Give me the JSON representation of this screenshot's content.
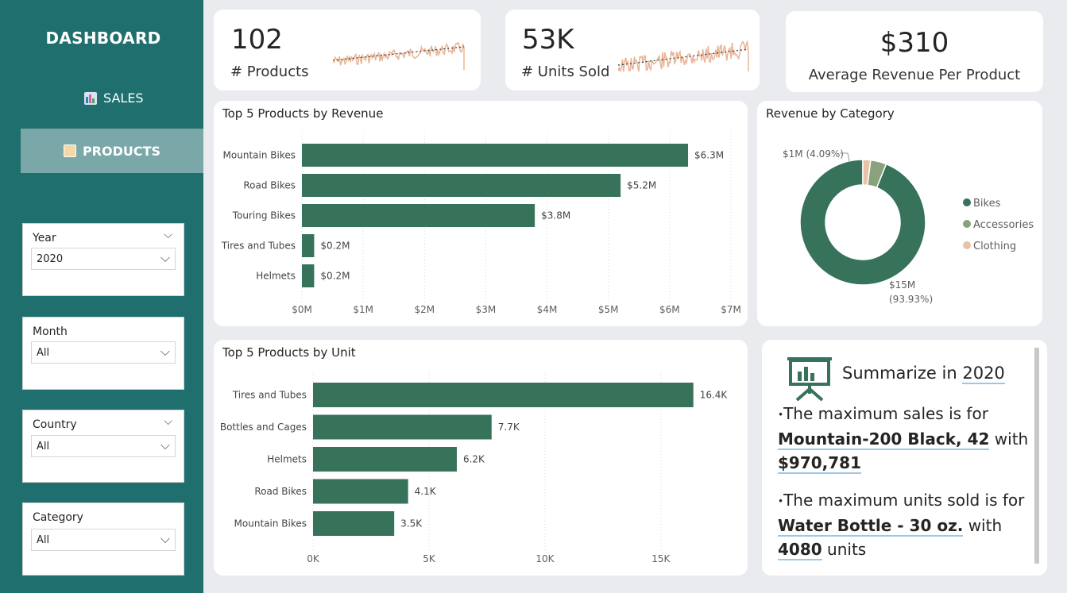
{
  "sidebar": {
    "title": "DASHBOARD",
    "nav": [
      {
        "label": "SALES"
      },
      {
        "label": "PRODUCTS"
      }
    ],
    "slicers": [
      {
        "label": "Year",
        "value": "2020"
      },
      {
        "label": "Month",
        "value": "All"
      },
      {
        "label": "Country",
        "value": "All"
      },
      {
        "label": "Category",
        "value": "All"
      }
    ]
  },
  "kpis": {
    "products": {
      "value": "102",
      "label": "# Products"
    },
    "units": {
      "value": "53K",
      "label": "# Units Sold"
    },
    "avg_rev": {
      "value": "$310",
      "label": "Average Revenue Per Product"
    }
  },
  "colors": {
    "sidebar": "#1f6f6e",
    "bar": "#36735a",
    "accessories": "#8aa27c",
    "clothing": "#e8c3a8",
    "sparkline": "#e8b596"
  },
  "chart_data": [
    {
      "type": "bar",
      "title": "Top 5 Products by Revenue",
      "categories": [
        "Mountain Bikes",
        "Road Bikes",
        "Touring Bikes",
        "Tires and Tubes",
        "Helmets"
      ],
      "values": [
        6.3,
        5.2,
        3.8,
        0.2,
        0.2
      ],
      "labels": [
        "$6.3M",
        "$5.2M",
        "$3.8M",
        "$0.2M",
        "$0.2M"
      ],
      "xticks": [
        "$0M",
        "$1M",
        "$2M",
        "$3M",
        "$4M",
        "$5M",
        "$6M",
        "$7M"
      ],
      "xlim": [
        0,
        7
      ],
      "grid": true
    },
    {
      "type": "pie",
      "title": "Revenue by Category",
      "labels": [
        "Bikes",
        "Accessories",
        "Clothing"
      ],
      "values": [
        93.93,
        4.09,
        1.98
      ],
      "annotations": [
        "$15M",
        "(93.93%)",
        "$1M (4.09%)"
      ],
      "legend": "right"
    },
    {
      "type": "bar",
      "title": "Top 5 Products by Unit",
      "categories": [
        "Tires and Tubes",
        "Bottles and Cages",
        "Helmets",
        "Road Bikes",
        "Mountain Bikes"
      ],
      "values": [
        16.4,
        7.7,
        6.2,
        4.1,
        3.5
      ],
      "labels": [
        "16.4K",
        "7.7K",
        "6.2K",
        "4.1K",
        "3.5K"
      ],
      "xticks": [
        "0K",
        "5K",
        "10K",
        "15K"
      ],
      "xlim": [
        0,
        18.5
      ],
      "grid": true
    }
  ],
  "summary": {
    "heading": "Summarize in",
    "year": "2020",
    "line1_pre": "The maximum sales is for",
    "line1_product": "Mountain-200 Black, 42",
    "line1_mid": "with",
    "line1_value": "$970,781",
    "line2_pre": "The maximum units sold is for",
    "line2_product": "Water Bottle - 30 oz.",
    "line2_mid": "with",
    "line2_value": "4080",
    "line2_post": "units"
  }
}
